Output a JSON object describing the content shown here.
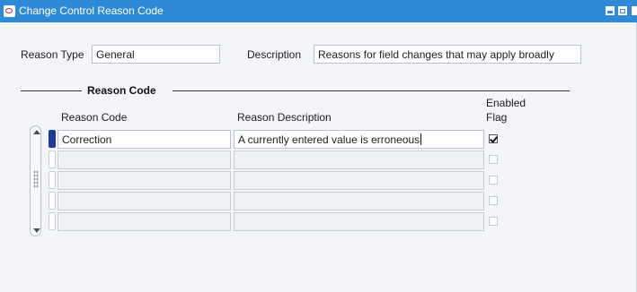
{
  "window": {
    "title": "Change Control Reason Code"
  },
  "header": {
    "reason_type_label": "Reason Type",
    "reason_type_value": "General",
    "description_label": "Description",
    "description_value": "Reasons for field changes that may apply broadly"
  },
  "group": {
    "title": "Reason Code"
  },
  "table": {
    "columns": {
      "reason_code": "Reason Code",
      "reason_description": "Reason Description",
      "enabled_flag_line1": "Enabled",
      "enabled_flag_line2": "Flag"
    },
    "rows": [
      {
        "code": "Correction",
        "description": "A currently entered value is erroneous",
        "enabled": true
      },
      {
        "code": "",
        "description": "",
        "enabled": false
      },
      {
        "code": "",
        "description": "",
        "enabled": false
      },
      {
        "code": "",
        "description": "",
        "enabled": false
      },
      {
        "code": "",
        "description": "",
        "enabled": false
      }
    ]
  },
  "icons": {
    "app_logo": "oracle-logo-icon",
    "minimize": "minimize-icon",
    "maximize": "maximize-icon",
    "scroll_up": "scroll-up-arrow-icon",
    "scroll_down": "scroll-down-arrow-icon",
    "checkbox": "checkbox-icon"
  },
  "colors": {
    "titlebar": "#2e8ad7",
    "current_record": "#1b3b95",
    "form_background": "#f3f5f8"
  }
}
